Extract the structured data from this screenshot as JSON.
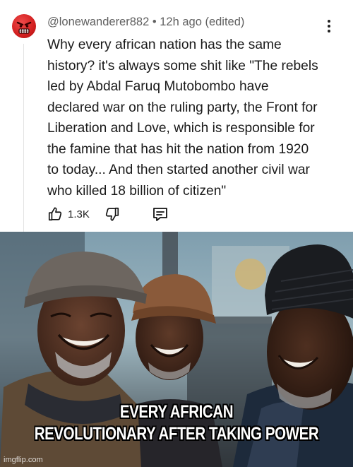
{
  "comment": {
    "username": "@lonewanderer882",
    "meta_separator": "•",
    "time": "12h ago (edited)",
    "body_lines": [
      "Why every african nation has the same",
      "history? it's always some shit like \"The rebels",
      "led by Abdal Faruq Mutobombo have",
      "declared war on the ruling party, the Front for",
      "Liberation and Love, which is responsible for",
      "the famine that has hit the nation from 1920",
      "to today... And then started another civil war",
      "who killed 18 billion of citizen\""
    ],
    "like_count": "1.3K",
    "icons": {
      "avatar": "angry-face-avatar",
      "menu": "vertical-ellipsis-icon",
      "like": "thumbs-up-icon",
      "dislike": "thumbs-down-icon",
      "reply": "reply-comment-icon"
    },
    "colors": {
      "avatar": "#d21f1f",
      "meta_text": "#606060",
      "body_text": "#1a1a1a"
    }
  },
  "meme": {
    "caption_lines": [
      "EVERY AFRICAN",
      "REVOLUTIONARY AFTER TAKING POWER"
    ],
    "watermark": "imgflip.com"
  }
}
